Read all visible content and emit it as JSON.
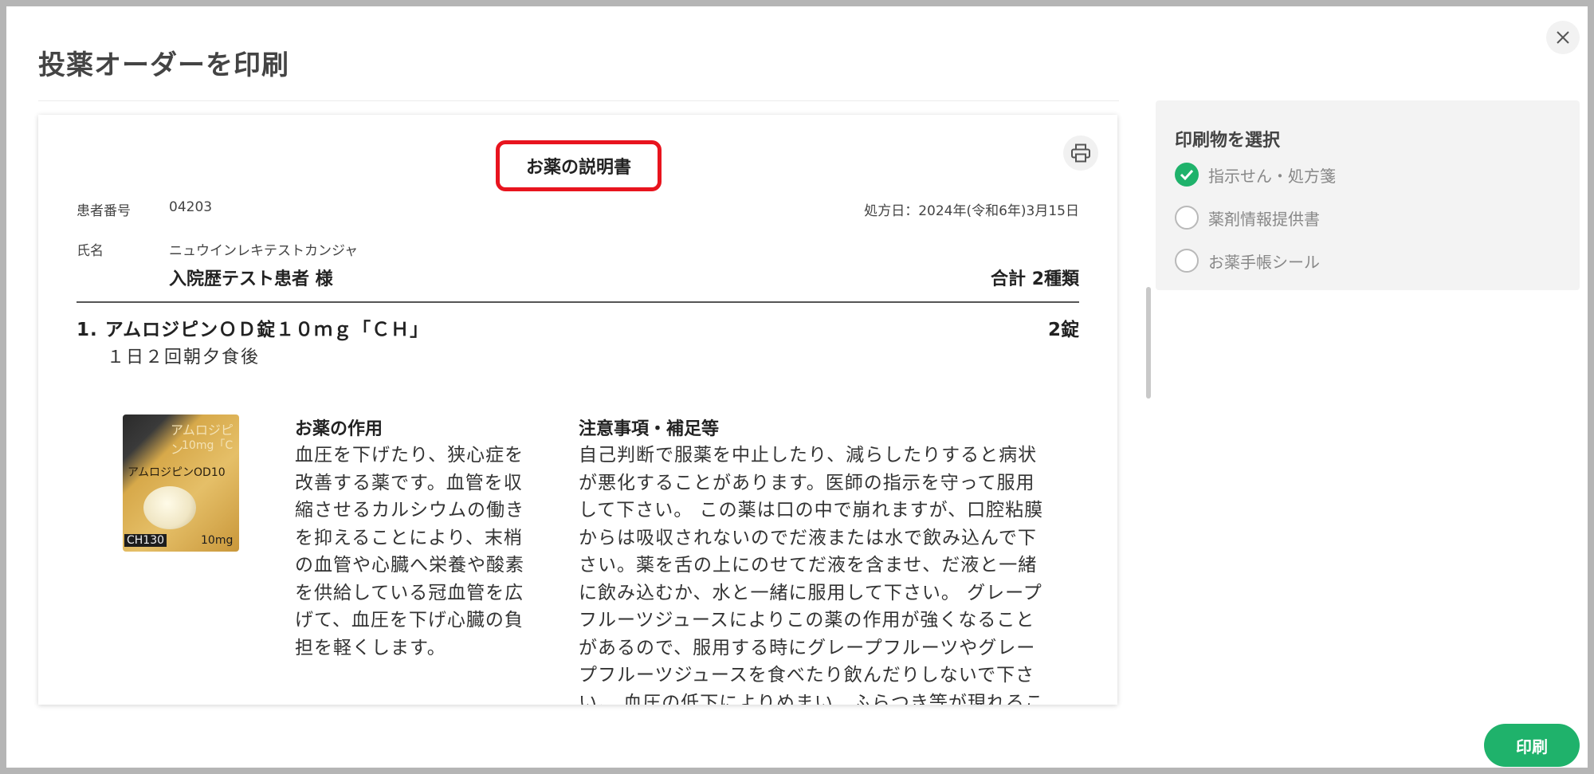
{
  "dialog": {
    "title": "投薬オーダーを印刷",
    "close_icon": "close-icon"
  },
  "document": {
    "title": "お薬の説明書",
    "print_icon": "printer-icon",
    "patient_number_label": "患者番号",
    "patient_number": "04203",
    "prescription_date": "処方日：2024年(令和6年)3月15日",
    "name_label": "氏名",
    "name_kana": "ニュウインレキテストカンジャ",
    "name": "入院歴テスト患者 様",
    "total": "合計 2種類",
    "medication": {
      "name": "1. アムロジピンＯＤ錠１０ｍｇ「ＣＨ」",
      "quantity": "2錠",
      "dosage": "１日２回朝夕食後",
      "package_text_1": "アムロジピン",
      "package_text_2": "10mg「C",
      "package_text_3": "アムロジピンOD10",
      "package_code": "CH130",
      "package_mg": "10mg",
      "effect_heading": "お薬の作用",
      "effect_lines": [
        "血圧を下げたり、狭心症を",
        "改善する薬です。血管を収",
        "縮させるカルシウムの働き",
        "を抑えることにより、末梢",
        "の血管や心臓へ栄養や酸素",
        "を供給している冠血管を広",
        "げて、血圧を下げ心臓の負",
        "担を軽くします。"
      ],
      "notes_heading": "注意事項・補足等",
      "notes_lines": [
        "自己判断で服薬を中止したり、減らしたりすると病状",
        "が悪化することがあります。医師の指示を守って服用",
        "して下さい。 この薬は口の中で崩れますが、口腔粘膜",
        "からは吸収されないのでだ液または水で飲み込んで下",
        "さい。薬を舌の上にのせてだ液を含ませ、だ液と一緒",
        "に飲み込むか、水と一緒に服用して下さい。 グレープ",
        "フルーツジュースによりこの薬の作用が強くなること",
        "があるので、服用する時にグレープフルーツやグレー",
        "プフルーツジュースを食べたり飲んだりしないで下さ",
        "い。 血圧の低下によりめまい、ふらつき等が現れるこ"
      ]
    }
  },
  "select_panel": {
    "title": "印刷物を選択",
    "options": [
      {
        "label": "指示せん・処方箋",
        "checked": true
      },
      {
        "label": "薬剤情報提供書",
        "checked": false
      },
      {
        "label": "お薬手帳シール",
        "checked": false
      }
    ]
  },
  "footer": {
    "print_label": "印刷"
  },
  "colors": {
    "accent_green": "#1fb26b",
    "highlight_red": "#e8141e"
  }
}
